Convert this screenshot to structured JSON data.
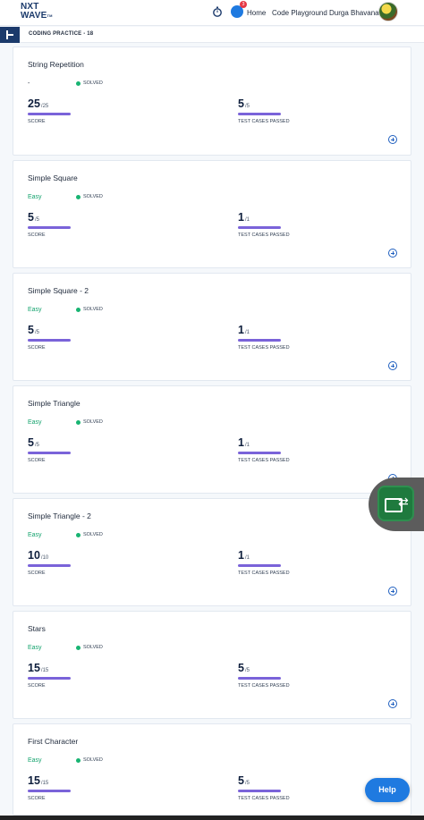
{
  "nav": {
    "logo_line1": "NXT",
    "logo_line2": "WAVE",
    "logo_tm": "TM",
    "badge_count": "3",
    "home_label": "Home",
    "playground_label": "Code Playground",
    "user_name": "Durga Bhavana"
  },
  "subheader": {
    "title": "CODING PRACTICE - 18"
  },
  "cards": [
    {
      "title": "String Repetition",
      "difficulty": "-",
      "status": "SOLVED",
      "score": "25",
      "score_total": "/25",
      "score_label": "SCORE",
      "tests": "5",
      "tests_total": "/5",
      "tests_label": "TEST CASES PASSED"
    },
    {
      "title": "Simple Square",
      "difficulty": "Easy",
      "status": "SOLVED",
      "score": "5",
      "score_total": "/5",
      "score_label": "SCORE",
      "tests": "1",
      "tests_total": "/1",
      "tests_label": "TEST CASES PASSED"
    },
    {
      "title": "Simple Square - 2",
      "difficulty": "Easy",
      "status": "SOLVED",
      "score": "5",
      "score_total": "/5",
      "score_label": "SCORE",
      "tests": "1",
      "tests_total": "/1",
      "tests_label": "TEST CASES PASSED"
    },
    {
      "title": "Simple Triangle",
      "difficulty": "Easy",
      "status": "SOLVED",
      "score": "5",
      "score_total": "/5",
      "score_label": "SCORE",
      "tests": "1",
      "tests_total": "/1",
      "tests_label": "TEST CASES PASSED"
    },
    {
      "title": "Simple Triangle - 2",
      "difficulty": "Easy",
      "status": "SOLVED",
      "score": "10",
      "score_total": "/10",
      "score_label": "SCORE",
      "tests": "1",
      "tests_total": "/1",
      "tests_label": "TEST CASES PASSED"
    },
    {
      "title": "Stars",
      "difficulty": "Easy",
      "status": "SOLVED",
      "score": "15",
      "score_total": "/15",
      "score_label": "SCORE",
      "tests": "5",
      "tests_total": "/5",
      "tests_label": "TEST CASES PASSED"
    },
    {
      "title": "First Character",
      "difficulty": "Easy",
      "status": "SOLVED",
      "score": "15",
      "score_total": "/15",
      "score_label": "SCORE",
      "tests": "5",
      "tests_total": "/5",
      "tests_label": "TEST CASES PASSED"
    }
  ],
  "help": {
    "label": "Help"
  },
  "colors": {
    "brand": "#1b3a6b",
    "accent": "#1f7ae0",
    "progress": "#7a63d9",
    "easy": "#15a36e",
    "solved": "#18b472"
  },
  "icons": {
    "timer": "stopwatch-icon",
    "chat": "chat-icon",
    "expand": "plus-circle-icon",
    "widget": "screen-share-icon"
  }
}
